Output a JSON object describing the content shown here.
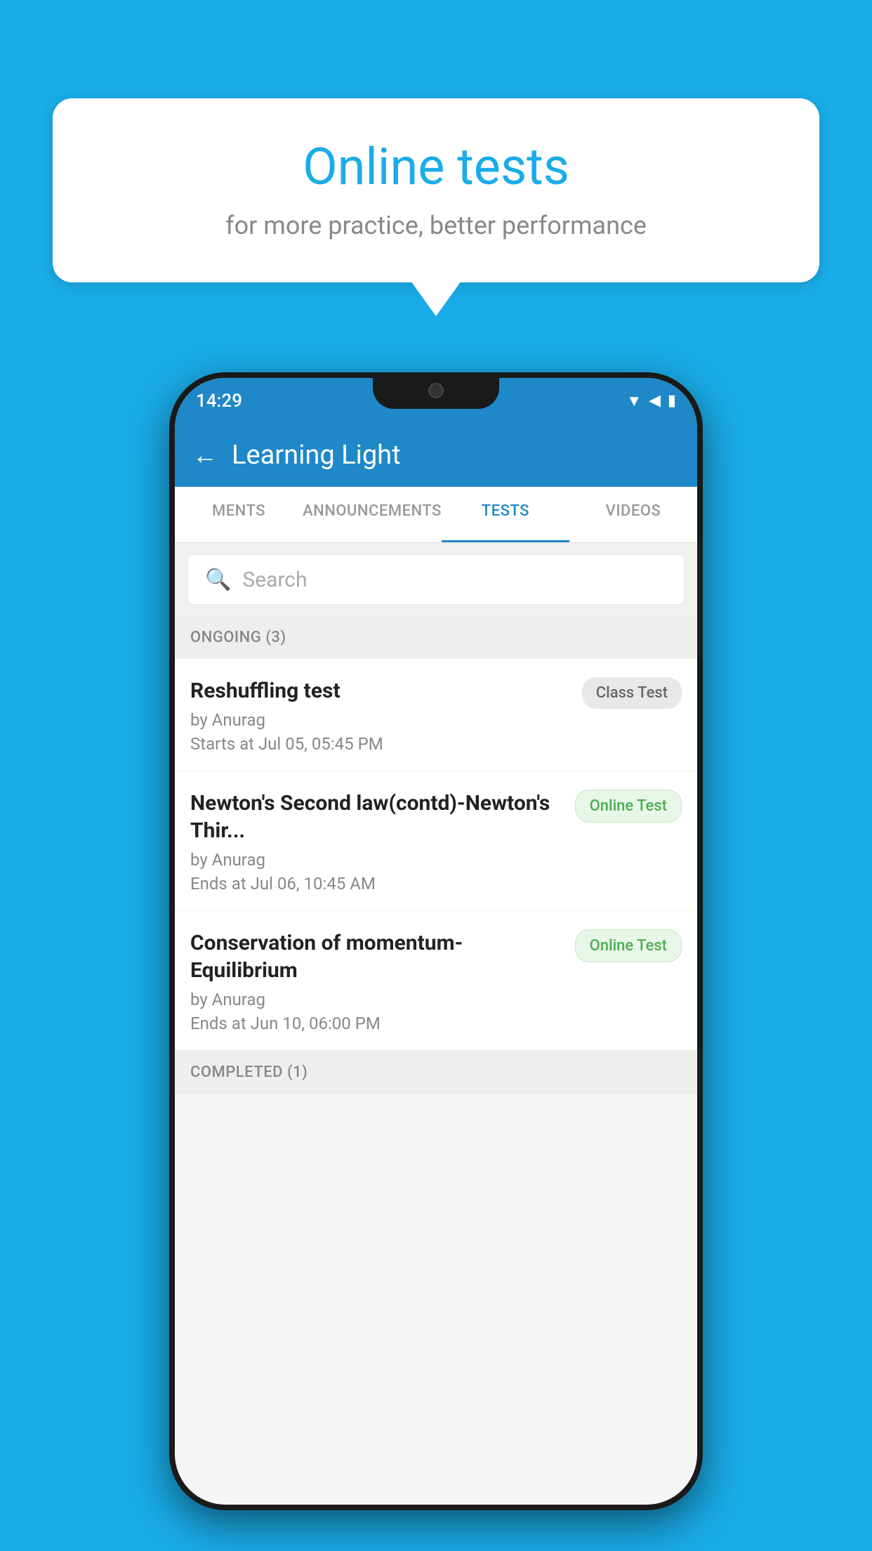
{
  "background_color": "#1AACE8",
  "speech_bubble": {
    "title": "Online tests",
    "subtitle": "for more practice, better performance"
  },
  "phone": {
    "status_bar": {
      "time": "14:29",
      "icons": [
        "wifi",
        "signal",
        "battery"
      ]
    },
    "app_header": {
      "title": "Learning Light",
      "back_label": "←"
    },
    "tabs": [
      {
        "label": "MENTS",
        "active": false
      },
      {
        "label": "ANNOUNCEMENTS",
        "active": false
      },
      {
        "label": "TESTS",
        "active": true
      },
      {
        "label": "VIDEOS",
        "active": false
      }
    ],
    "search": {
      "placeholder": "Search"
    },
    "ongoing_section": {
      "label": "ONGOING (3)"
    },
    "tests": [
      {
        "name": "Reshuffling test",
        "author": "by Anurag",
        "time_label": "Starts at",
        "time": "Jul 05, 05:45 PM",
        "badge": "Class Test",
        "badge_type": "class"
      },
      {
        "name": "Newton's Second law(contd)-Newton's Thir...",
        "author": "by Anurag",
        "time_label": "Ends at",
        "time": "Jul 06, 10:45 AM",
        "badge": "Online Test",
        "badge_type": "online"
      },
      {
        "name": "Conservation of momentum-Equilibrium",
        "author": "by Anurag",
        "time_label": "Ends at",
        "time": "Jun 10, 06:00 PM",
        "badge": "Online Test",
        "badge_type": "online"
      }
    ],
    "completed_section": {
      "label": "COMPLETED (1)"
    }
  }
}
